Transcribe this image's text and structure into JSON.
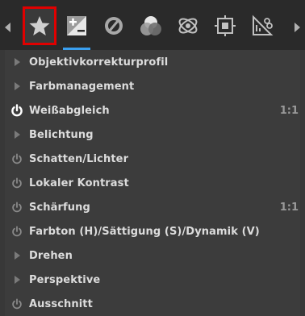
{
  "toolbar": {
    "tabs": [
      {
        "icon": "favorites-star-icon",
        "selected": true
      },
      {
        "icon": "exposure-icon",
        "selected": false,
        "underlined": true
      },
      {
        "icon": "detail-icon",
        "selected": false
      },
      {
        "icon": "color-icon",
        "selected": false
      },
      {
        "icon": "advanced-icon",
        "selected": false
      },
      {
        "icon": "transform-icon",
        "selected": false
      },
      {
        "icon": "raw-icon",
        "selected": false
      }
    ]
  },
  "tools": [
    {
      "label": "Objektivkorrekturprofil",
      "lead": "expander",
      "badge": ""
    },
    {
      "label": "Farbmanagement",
      "lead": "expander",
      "badge": ""
    },
    {
      "label": "Weißabgleich",
      "lead": "power-on",
      "badge": "1:1"
    },
    {
      "label": "Belichtung",
      "lead": "expander",
      "badge": ""
    },
    {
      "label": "Schatten/Lichter",
      "lead": "power-off",
      "badge": ""
    },
    {
      "label": "Lokaler Kontrast",
      "lead": "power-off",
      "badge": ""
    },
    {
      "label": "Schärfung",
      "lead": "power-off",
      "badge": "1:1"
    },
    {
      "label": "Farbton (H)/Sättigung (S)/Dynamik (V)",
      "lead": "power-off",
      "badge": ""
    },
    {
      "label": "Drehen",
      "lead": "expander",
      "badge": ""
    },
    {
      "label": "Perspektive",
      "lead": "expander",
      "badge": ""
    },
    {
      "label": "Ausschnitt",
      "lead": "power-off",
      "badge": ""
    }
  ],
  "colors": {
    "selected_border": "#e00000",
    "accent_underline": "#3aa0f0",
    "text": "#dcdcdc",
    "power_on": "#ffffff",
    "power_off": "#8a8a8a"
  }
}
